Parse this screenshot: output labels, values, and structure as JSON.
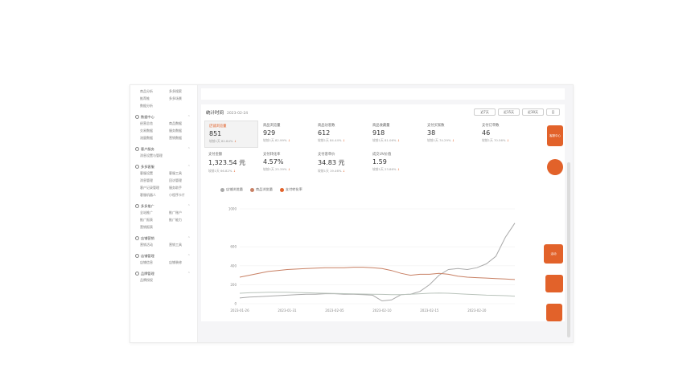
{
  "sidebar": {
    "groups": [
      {
        "head": "",
        "items": [
          "商品分析",
          "多多搜索",
          "推荐推",
          "多多场景",
          "数据分析",
          ""
        ]
      },
      {
        "head": "数据中心",
        "items": [
          "经营总览",
          "商品数据",
          "交易数据",
          "服务数据",
          "流量数据",
          "营销数据"
        ]
      },
      {
        "head": "客户服务",
        "items": [
          "消息设置与管理",
          ""
        ]
      },
      {
        "head": "多多客服",
        "items": [
          "客服设置",
          "客服工具",
          "消息管理",
          "回访管理",
          "客户记录管理",
          "服务助手",
          "客服机器人",
          "小程序卡片"
        ]
      },
      {
        "head": "多多推广",
        "items": [
          "全站推广",
          "推广账户",
          "推广报表",
          "推广能力",
          "营销报表",
          ""
        ]
      },
      {
        "head": "店铺营销",
        "items": [
          "营销活动",
          "营销工具"
        ]
      },
      {
        "head": "店铺管理",
        "items": [
          "店铺信息",
          "店铺装修"
        ]
      },
      {
        "head": "品牌管理",
        "items": [
          "品牌授权",
          ""
        ]
      }
    ]
  },
  "panel": {
    "title": "统计时间",
    "date": "2023-02-24",
    "range_buttons": [
      "近7天",
      "近15天",
      "近30天",
      "日"
    ]
  },
  "metrics": [
    {
      "label": "店铺浏览量",
      "value": "851",
      "compare": "较前1天 82.84%"
    },
    {
      "label": "商品浏览量",
      "value": "929",
      "compare": "较前1天 82.99%"
    },
    {
      "label": "商品访客数",
      "value": "612",
      "compare": "较前1天 84.44%"
    },
    {
      "label": "商品收藏量",
      "value": "918",
      "compare": "较前1天 81.06%"
    },
    {
      "label": "支付买家数",
      "value": "38",
      "compare": "较前1天 74.29%"
    },
    {
      "label": "支付订单数",
      "value": "46",
      "compare": "较前1天 70.56%"
    },
    {
      "label": "支付金额",
      "value": "1,323.54 元",
      "compare": "较前1天 66.82%"
    },
    {
      "label": "支付转化率",
      "value": "4.57%",
      "compare": "较前1天 25.39%"
    },
    {
      "label": "支付客单价",
      "value": "34.83 元",
      "compare": "较前1天 19.46%"
    },
    {
      "label": "成交UV价值",
      "value": "1.59",
      "compare": "较前1天 23.86%"
    }
  ],
  "legend": [
    "店铺浏览量",
    "商品浏览量",
    "支付转化率"
  ],
  "colors": {
    "accent": "#e2622a",
    "s1": "#a9a9a9",
    "s2": "#c88064",
    "s3": "#b9c3bb"
  },
  "chart_data": {
    "type": "line",
    "x": [
      "2023-01-26",
      "2023-01-27",
      "2023-01-28",
      "2023-01-29",
      "2023-01-30",
      "2023-01-31",
      "2023-02-01",
      "2023-02-02",
      "2023-02-03",
      "2023-02-04",
      "2023-02-05",
      "2023-02-06",
      "2023-02-07",
      "2023-02-08",
      "2023-02-09",
      "2023-02-10",
      "2023-02-11",
      "2023-02-12",
      "2023-02-13",
      "2023-02-14",
      "2023-02-15",
      "2023-02-16",
      "2023-02-17",
      "2023-02-18",
      "2023-02-19",
      "2023-02-20",
      "2023-02-21",
      "2023-02-22",
      "2023-02-23",
      "2023-02-24"
    ],
    "xticks": [
      "2023-01-26",
      "2023-01-31",
      "2023-02-05",
      "2023-02-10",
      "2023-02-15",
      "2023-02-20"
    ],
    "ylim": [
      0,
      1000
    ],
    "yticks": [
      "0",
      "200",
      "400",
      "600",
      "1000"
    ],
    "series": [
      {
        "name": "店铺浏览量",
        "values": [
          60,
          70,
          75,
          80,
          85,
          90,
          95,
          100,
          100,
          105,
          105,
          100,
          100,
          95,
          90,
          30,
          40,
          95,
          100,
          130,
          200,
          300,
          360,
          370,
          360,
          380,
          420,
          500,
          700,
          850
        ]
      },
      {
        "name": "商品浏览量",
        "values": [
          280,
          300,
          320,
          340,
          350,
          360,
          365,
          370,
          375,
          380,
          380,
          380,
          385,
          385,
          380,
          370,
          350,
          320,
          300,
          310,
          310,
          320,
          310,
          290,
          280,
          275,
          270,
          265,
          260,
          255
        ]
      },
      {
        "name": "支付转化率",
        "values": [
          110,
          115,
          118,
          120,
          120,
          120,
          118,
          115,
          112,
          110,
          108,
          106,
          104,
          102,
          100,
          98,
          96,
          95,
          100,
          105,
          110,
          112,
          110,
          105,
          100,
          95,
          90,
          88,
          85,
          80
        ]
      }
    ]
  },
  "floating": [
    {
      "label": "客服中心",
      "color": "#e2622a"
    },
    {
      "label": "",
      "color": "#e2622a"
    },
    {
      "label": "活动",
      "color": "#e2622a"
    },
    {
      "label": "",
      "color": "#e2622a"
    },
    {
      "label": "",
      "color": "#e2622a"
    }
  ]
}
